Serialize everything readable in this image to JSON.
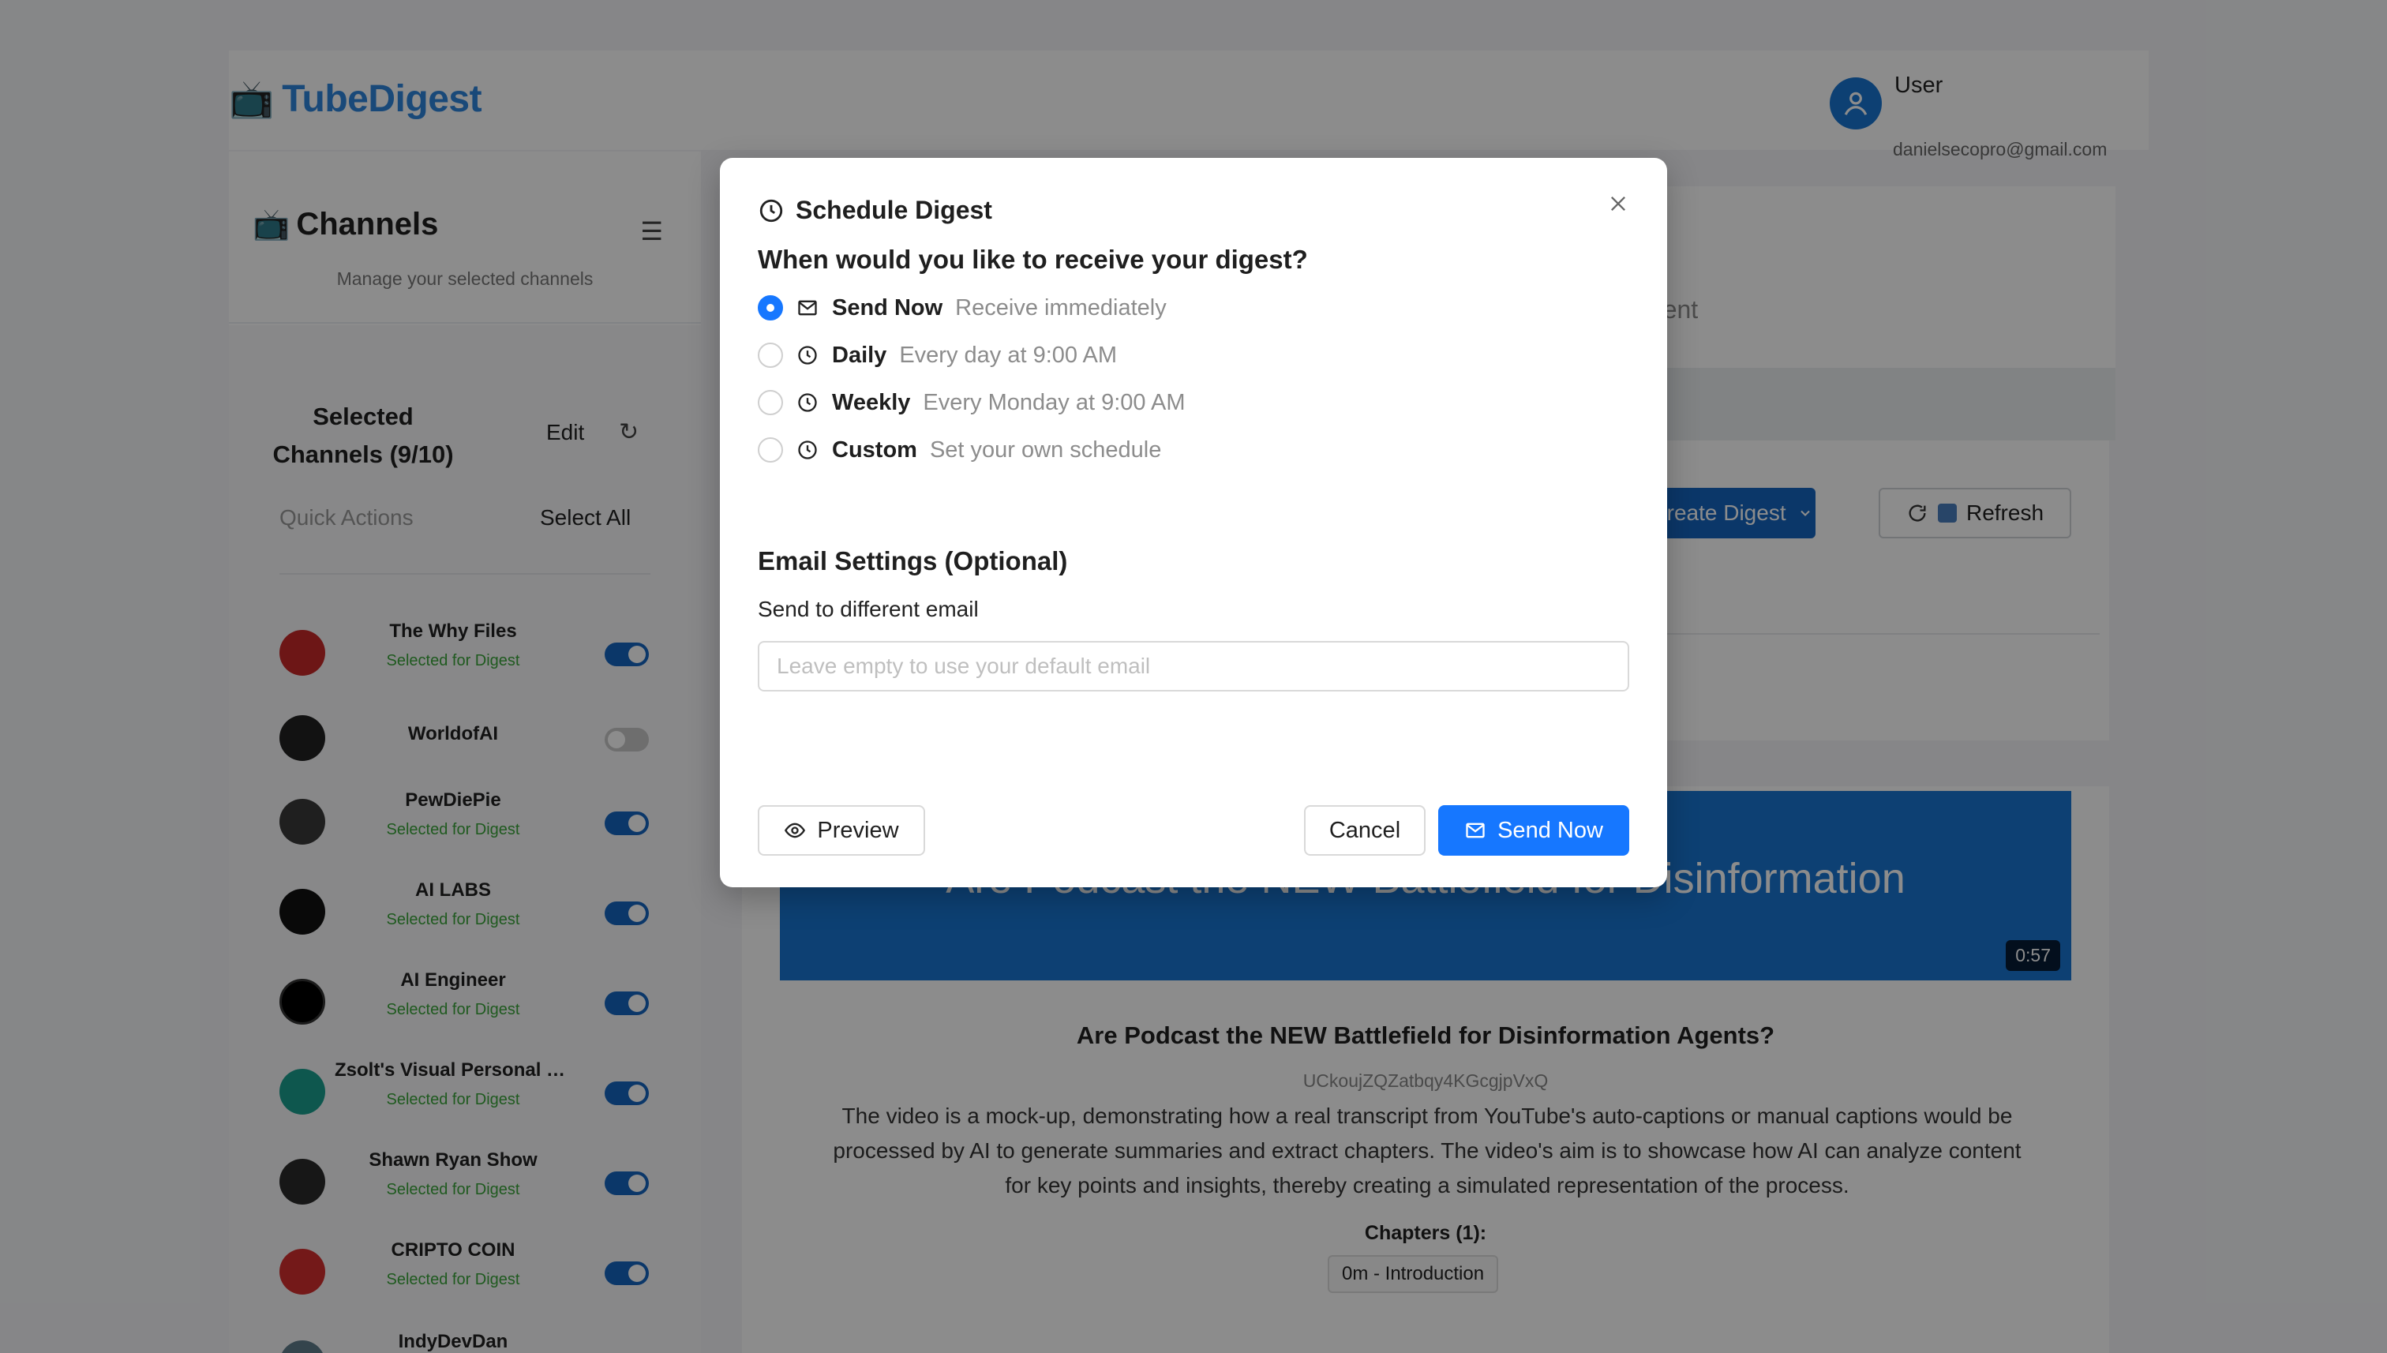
{
  "header": {
    "brand_icon": "tv-icon",
    "brand_name": "TubeDigest",
    "user_name": "User",
    "user_email": "danielsecopro@gmail.com"
  },
  "sidebar": {
    "title": "Channels",
    "subtitle": "Manage your selected channels",
    "selected_title": "Selected Channels (9/10)",
    "edit_label": "Edit",
    "quick_actions_label": "Quick Actions",
    "select_all_label": "Select All",
    "channels": [
      {
        "name": "The Why Files",
        "status": "Selected for Digest",
        "enabled": true
      },
      {
        "name": "WorldofAI",
        "status": "",
        "enabled": false
      },
      {
        "name": "PewDiePie",
        "status": "Selected for Digest",
        "enabled": true
      },
      {
        "name": "AI LABS",
        "status": "Selected for Digest",
        "enabled": true
      },
      {
        "name": "AI Engineer",
        "status": "Selected for Digest",
        "enabled": true
      },
      {
        "name": "Zsolt's Visual Personal Kn...",
        "status": "Selected for Digest",
        "enabled": true
      },
      {
        "name": "Shawn Ryan Show",
        "status": "Selected for Digest",
        "enabled": true
      },
      {
        "name": "CRIPTO COIN",
        "status": "Selected for Digest",
        "enabled": true
      },
      {
        "name": "IndyDevDan",
        "status": "",
        "enabled": true
      }
    ]
  },
  "main": {
    "tab_fragment": "ntent",
    "create_digest_label": "Create Digest",
    "refresh_label": "Refresh",
    "video": {
      "thumbnail_text": "Are Podcast the NEW Battlefield for Disinformation",
      "duration": "0:57",
      "title": "Are Podcast the NEW Battlefield for Disinformation Agents?",
      "channel_id": "UCkoujZQZatbqy4KGcgjpVxQ",
      "description": "The video is a mock-up, demonstrating how a real transcript from YouTube's auto-captions or manual captions would be processed by AI to generate summaries and extract chapters. The video's aim is to showcase how AI can analyze content for key points and insights, thereby creating a simulated representation of the process.",
      "chapters_label": "Chapters (1):",
      "chapters": [
        "0m - Introduction"
      ]
    }
  },
  "modal": {
    "title": "Schedule Digest",
    "question": "When would you like to receive your digest?",
    "options": [
      {
        "label": "Send Now",
        "description": "Receive immediately",
        "icon": "mail-icon",
        "checked": true
      },
      {
        "label": "Daily",
        "description": "Every day at 9:00 AM",
        "icon": "clock-icon",
        "checked": false
      },
      {
        "label": "Weekly",
        "description": "Every Monday at 9:00 AM",
        "icon": "clock-icon",
        "checked": false
      },
      {
        "label": "Custom",
        "description": "Set your own schedule",
        "icon": "clock-icon",
        "checked": false
      }
    ],
    "email_section_title": "Email Settings (Optional)",
    "email_label": "Send to different email",
    "email_value": "",
    "email_placeholder": "Leave empty to use your default email",
    "preview_label": "Preview",
    "cancel_label": "Cancel",
    "send_label": "Send Now"
  },
  "colors": {
    "brand": "#2f86dd",
    "primary": "#1677ff",
    "sidebar_toggle_on": "#1565c0",
    "selected_text": "#3aa43a",
    "thumbnail_bg": "#1976d2"
  }
}
